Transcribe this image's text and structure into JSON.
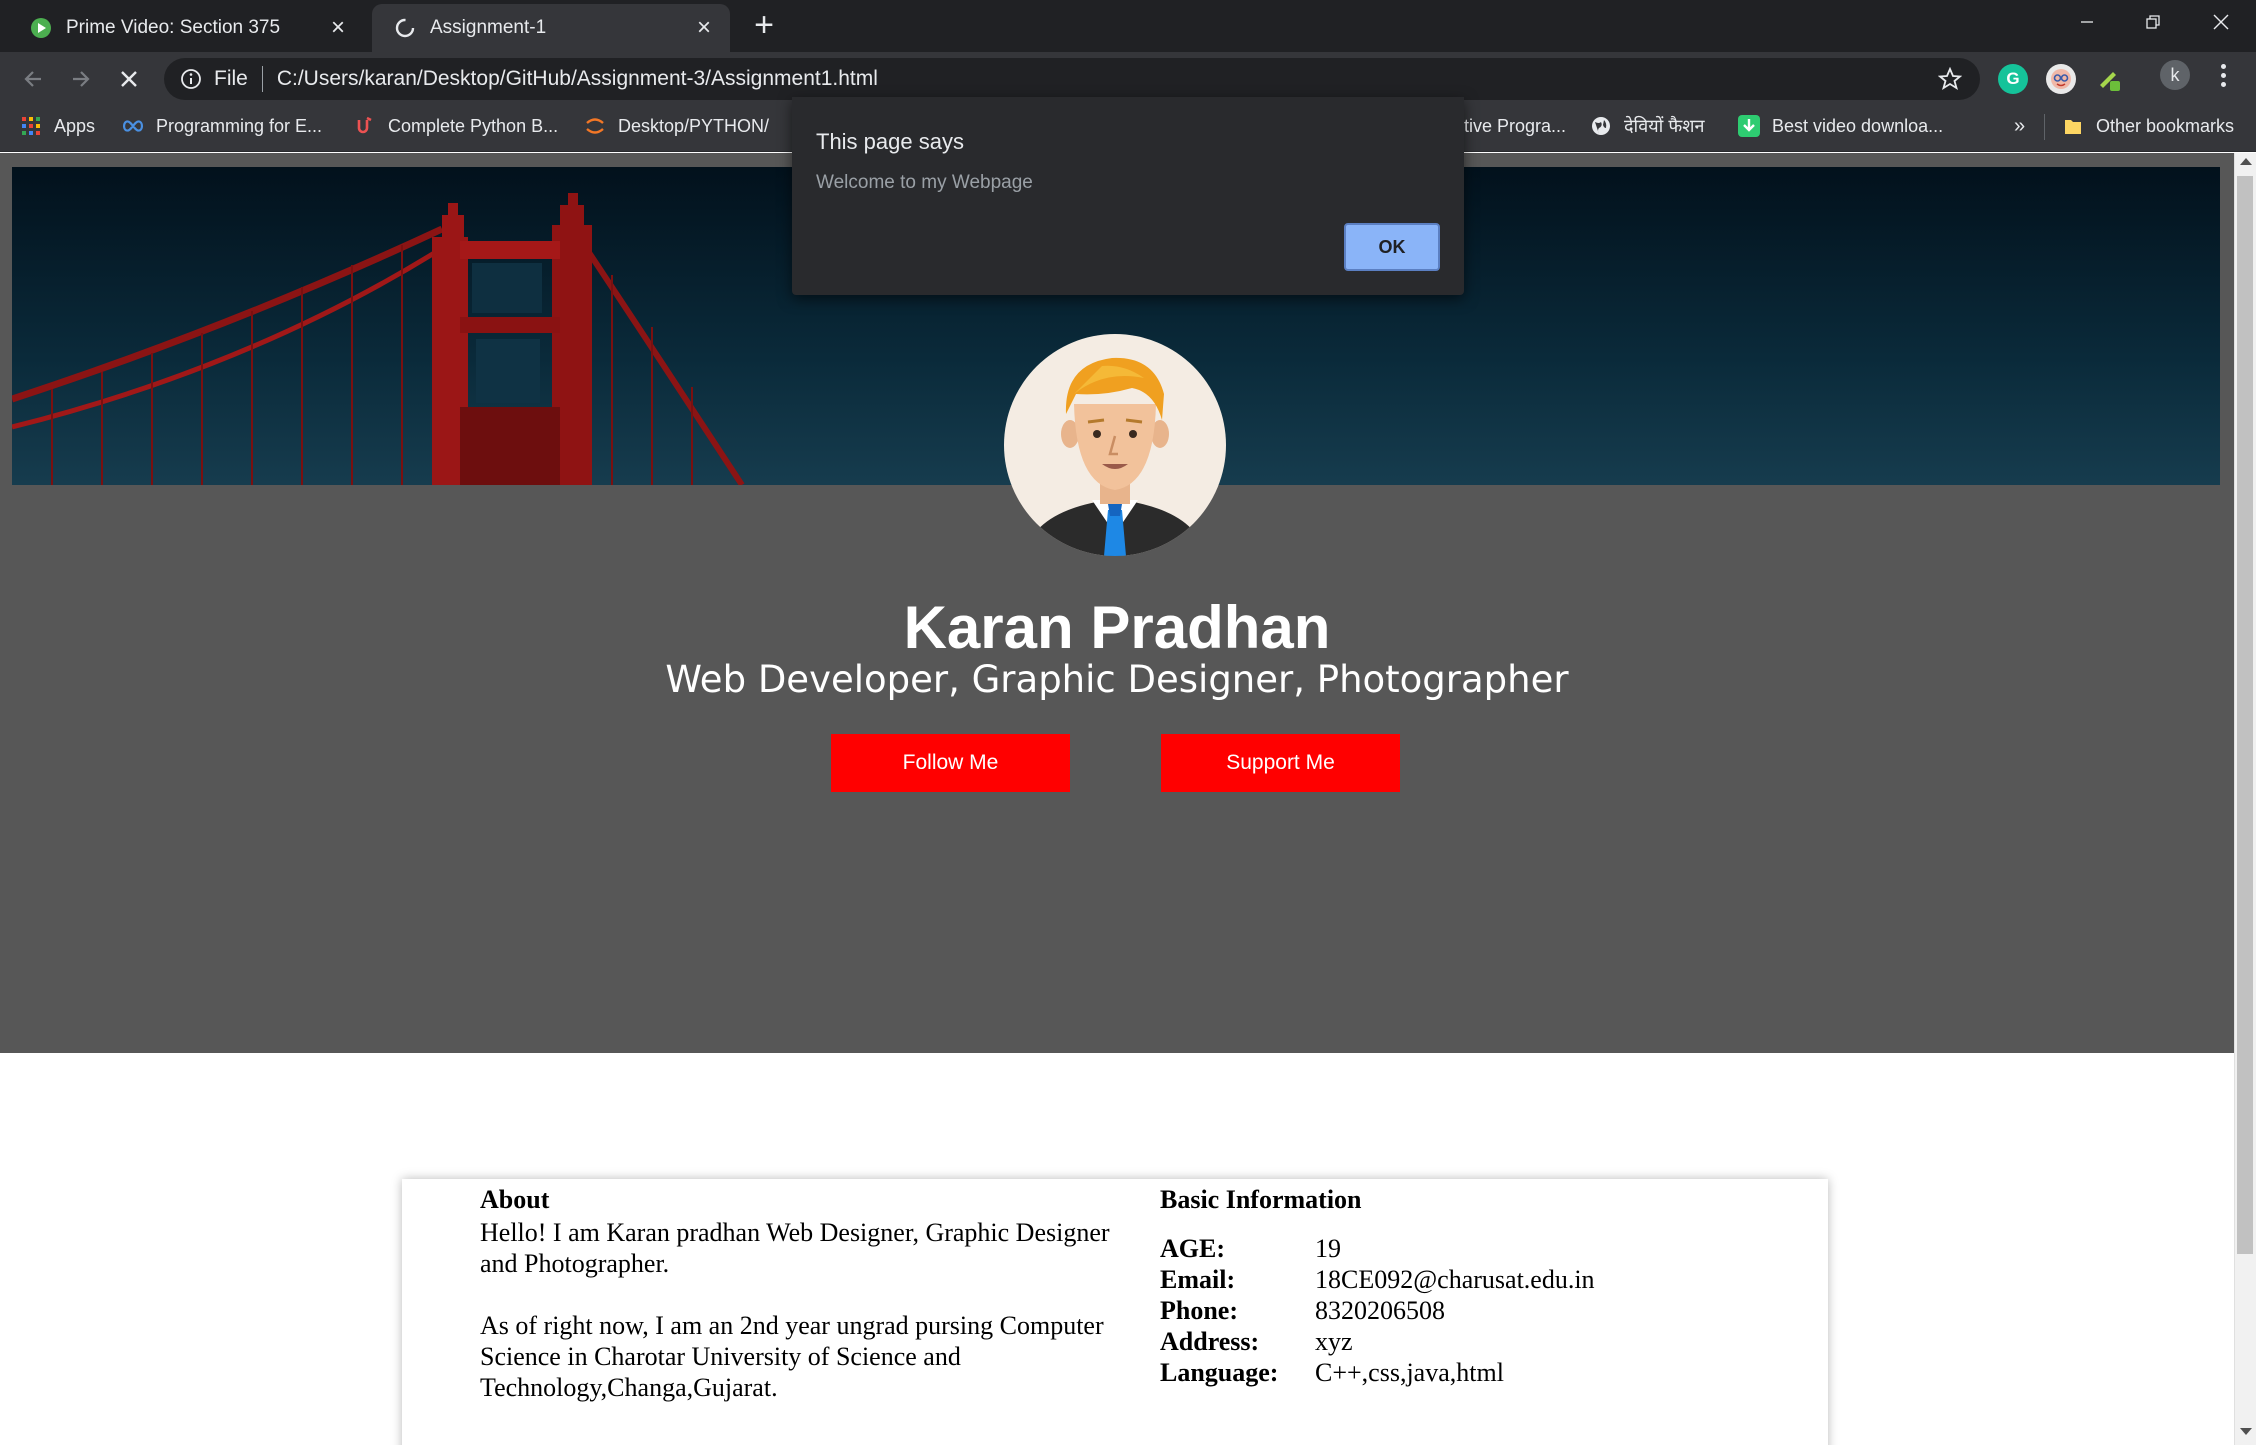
{
  "browser": {
    "tabs": [
      {
        "title": "Prime Video: Section 375",
        "favicon": "prime-video-icon",
        "active": false
      },
      {
        "title": "Assignment-1",
        "favicon": "loading-spinner-icon",
        "active": true
      }
    ],
    "address": {
      "scheme_label": "File",
      "url": "C:/Users/karan/Desktop/GitHub/Assignment-3/Assignment1.html"
    },
    "profile_initial": "k",
    "bookmarks": [
      {
        "label": "Apps",
        "icon": "apps-grid-icon"
      },
      {
        "label": "Programming for E...",
        "icon": "infinity-icon"
      },
      {
        "label": "Complete Python B...",
        "icon": "udemy-icon"
      },
      {
        "label": "Desktop/PYTHON/",
        "icon": "jupyter-icon"
      },
      {
        "label": "tive Progra...",
        "icon": "bookmark-icon"
      },
      {
        "label": "देवियों फैशन",
        "icon": "globe-icon"
      },
      {
        "label": "Best video downloa...",
        "icon": "download-icon"
      },
      {
        "label": "»",
        "icon": "chevron-more-icon"
      },
      {
        "label": "Other bookmarks",
        "icon": "folder-icon"
      }
    ]
  },
  "dialog": {
    "title": "This page says",
    "message": "Welcome to my Webpage",
    "ok_label": "OK"
  },
  "profile": {
    "name": "Karan Pradhan",
    "roles": "Web Developer, Graphic Designer, Photographer",
    "follow_label": "Follow Me",
    "support_label": "Support Me"
  },
  "about": {
    "heading": "About",
    "para1": "Hello! I am Karan pradhan Web Designer, Graphic Designer and Photographer.",
    "para2": "As of right now, I am an 2nd year ungrad pursing Computer Science in Charotar University of Science and Technology,Changa,Gujarat."
  },
  "basic_info": {
    "heading": "Basic Information",
    "rows": [
      {
        "label": "AGE:",
        "value": "19"
      },
      {
        "label": "Email:",
        "value": "18CE092@charusat.edu.in"
      },
      {
        "label": "Phone:",
        "value": "8320206508"
      },
      {
        "label": "Address:",
        "value": "xyz"
      },
      {
        "label": "Language:",
        "value": "C++,css,java,html"
      }
    ]
  },
  "colors": {
    "hero_bg": "#575757",
    "button_bg": "#ff0000",
    "dialog_bg": "#292a2d",
    "dialog_ok": "#8ab4f8",
    "chrome_dark": "#202124"
  }
}
